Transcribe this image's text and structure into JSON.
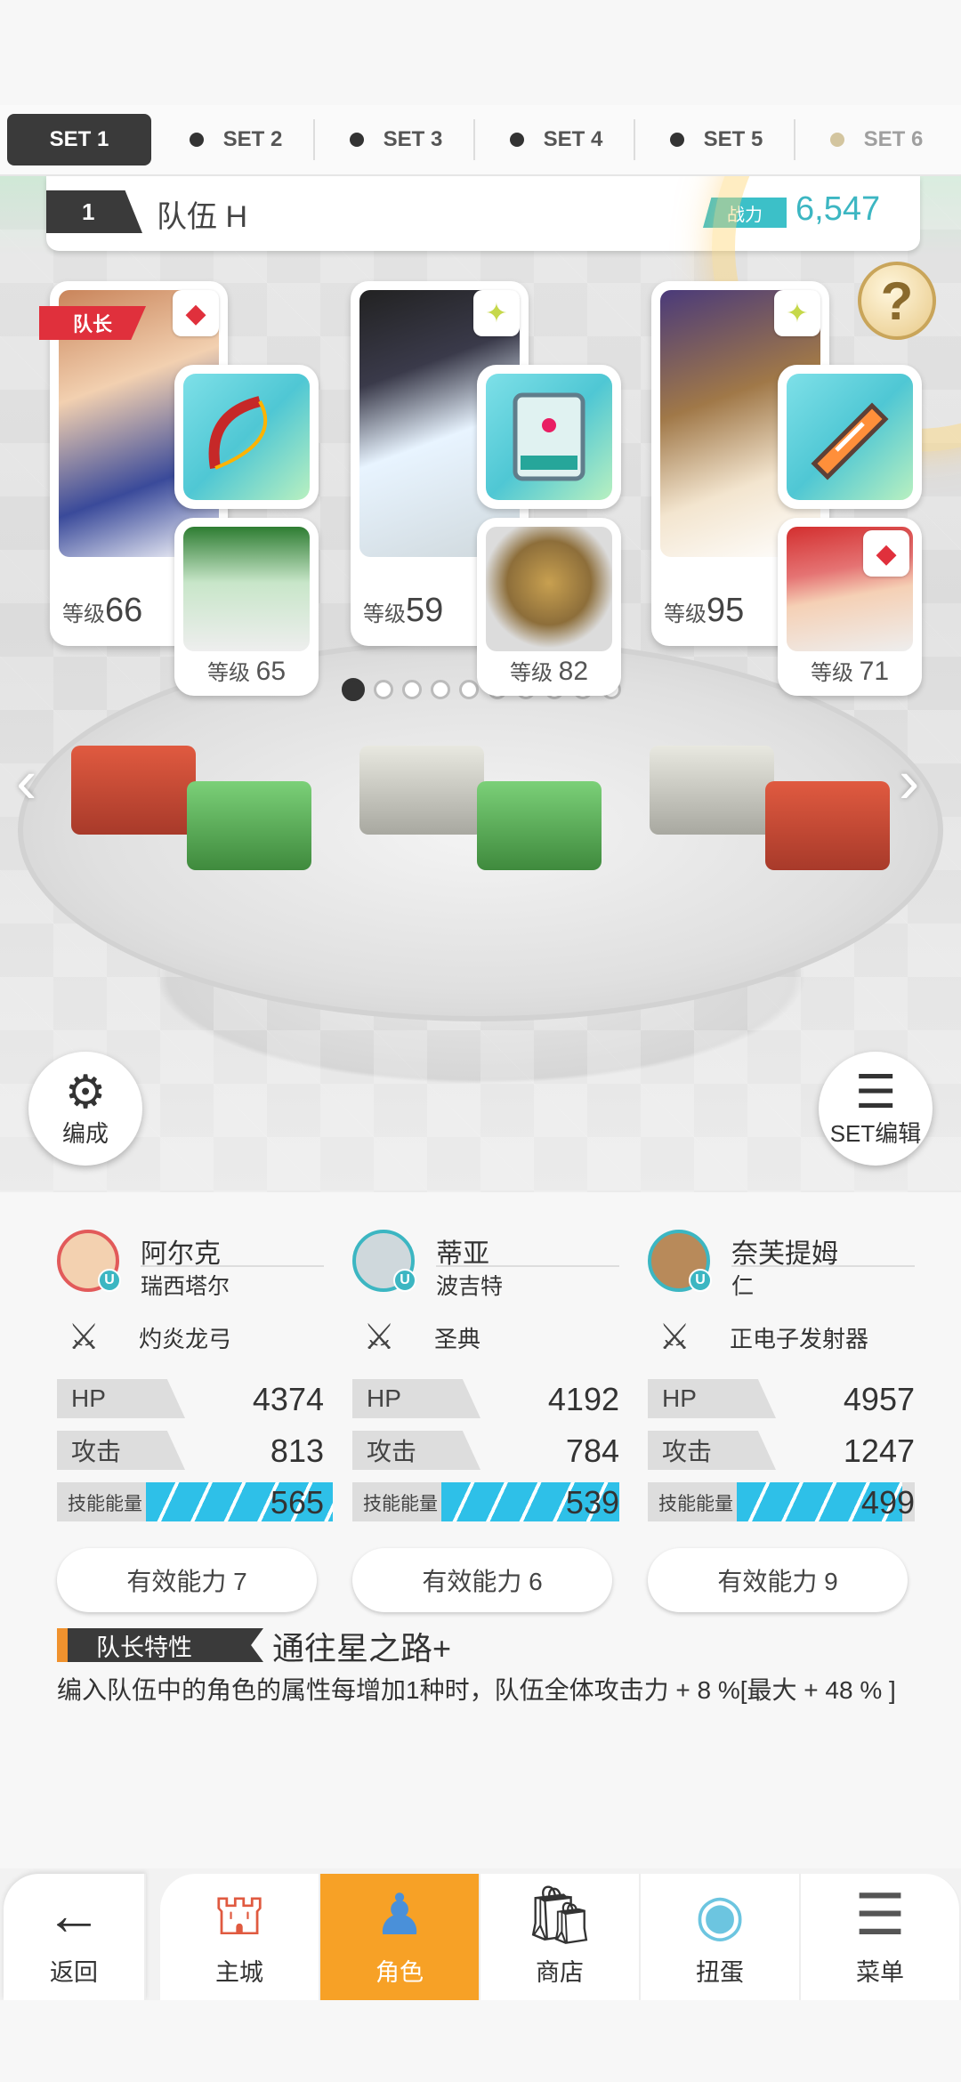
{
  "set_tabs": [
    {
      "label": "SET 1",
      "active": true
    },
    {
      "label": "SET 2",
      "active": false
    },
    {
      "label": "SET 3",
      "active": false
    },
    {
      "label": "SET 4",
      "active": false
    },
    {
      "label": "SET 5",
      "active": false
    },
    {
      "label": "SET 6",
      "active": false
    }
  ],
  "team": {
    "number": "1",
    "name": "队伍 H",
    "power_label": "战力",
    "power_value": "6,547"
  },
  "help_icon": "question-icon",
  "leader_tag": "队长",
  "cards": [
    {
      "level_prefix": "等级",
      "level": "66",
      "element_icon": "red-diamond-icon",
      "support_level": "65"
    },
    {
      "level_prefix": "等级",
      "level": "59",
      "element_icon": "sparkle-icon",
      "support_level": "82"
    },
    {
      "level_prefix": "等级",
      "level": "95",
      "element_icon": "sparkle-icon",
      "support_level": "71"
    }
  ],
  "support_prefix": "等级",
  "page_dots": {
    "count": 10,
    "active_index": 0
  },
  "edit_button": {
    "label": "编成",
    "icon": "person-gear-icon"
  },
  "set_edit_button": {
    "label": "SET编辑",
    "icon": "list-icon"
  },
  "columns": [
    {
      "name": "阿尔克",
      "sub": "瑞西塔尔",
      "weapon": "灼炎龙弓",
      "hp_label": "HP",
      "hp": "4374",
      "atk_label": "攻击",
      "atk": "813",
      "energy_label": "技能能量",
      "energy": "565",
      "energy_fill_pct": 70,
      "ability": "有效能力 7",
      "avatar_border": "#e25a5a"
    },
    {
      "name": "蒂亚",
      "sub": "波吉特",
      "weapon": "圣典",
      "hp_label": "HP",
      "hp": "4192",
      "atk_label": "攻击",
      "atk": "784",
      "energy_label": "技能能量",
      "energy": "539",
      "energy_fill_pct": 67,
      "ability": "有效能力 6",
      "avatar_border": "#3cb6c2"
    },
    {
      "name": "奈芙提姆",
      "sub": "仁",
      "weapon": "正电子发射器",
      "hp_label": "HP",
      "hp": "4957",
      "atk_label": "攻击",
      "atk": "1247",
      "energy_label": "技能能量",
      "energy": "499",
      "energy_fill_pct": 62,
      "ability": "有效能力 9",
      "avatar_border": "#3cb6c2"
    }
  ],
  "trait": {
    "tag": "队长特性",
    "name": "通往星之路+",
    "description": "编入队伍中的角色的属性每增加1种时，队伍全体攻击力 + 8 %[最大 + 48 % ]"
  },
  "nav": [
    {
      "label": "返回",
      "icon": "back-arrow-icon",
      "glyph": "←"
    },
    {
      "label": "主城",
      "icon": "castle-icon",
      "glyph": "⛫"
    },
    {
      "label": "角色",
      "icon": "character-icon",
      "glyph": "♟",
      "active": true
    },
    {
      "label": "商店",
      "icon": "shop-bag-icon",
      "glyph": "🛍"
    },
    {
      "label": "扭蛋",
      "icon": "gacha-orb-icon",
      "glyph": "◉"
    },
    {
      "label": "菜单",
      "icon": "menu-list-icon",
      "glyph": "☰"
    }
  ],
  "colors": {
    "accent_orange": "#f7a126",
    "accent_teal": "#3cb6c2",
    "leader_red": "#e0303c",
    "energy_blue": "#2ec0e8"
  }
}
